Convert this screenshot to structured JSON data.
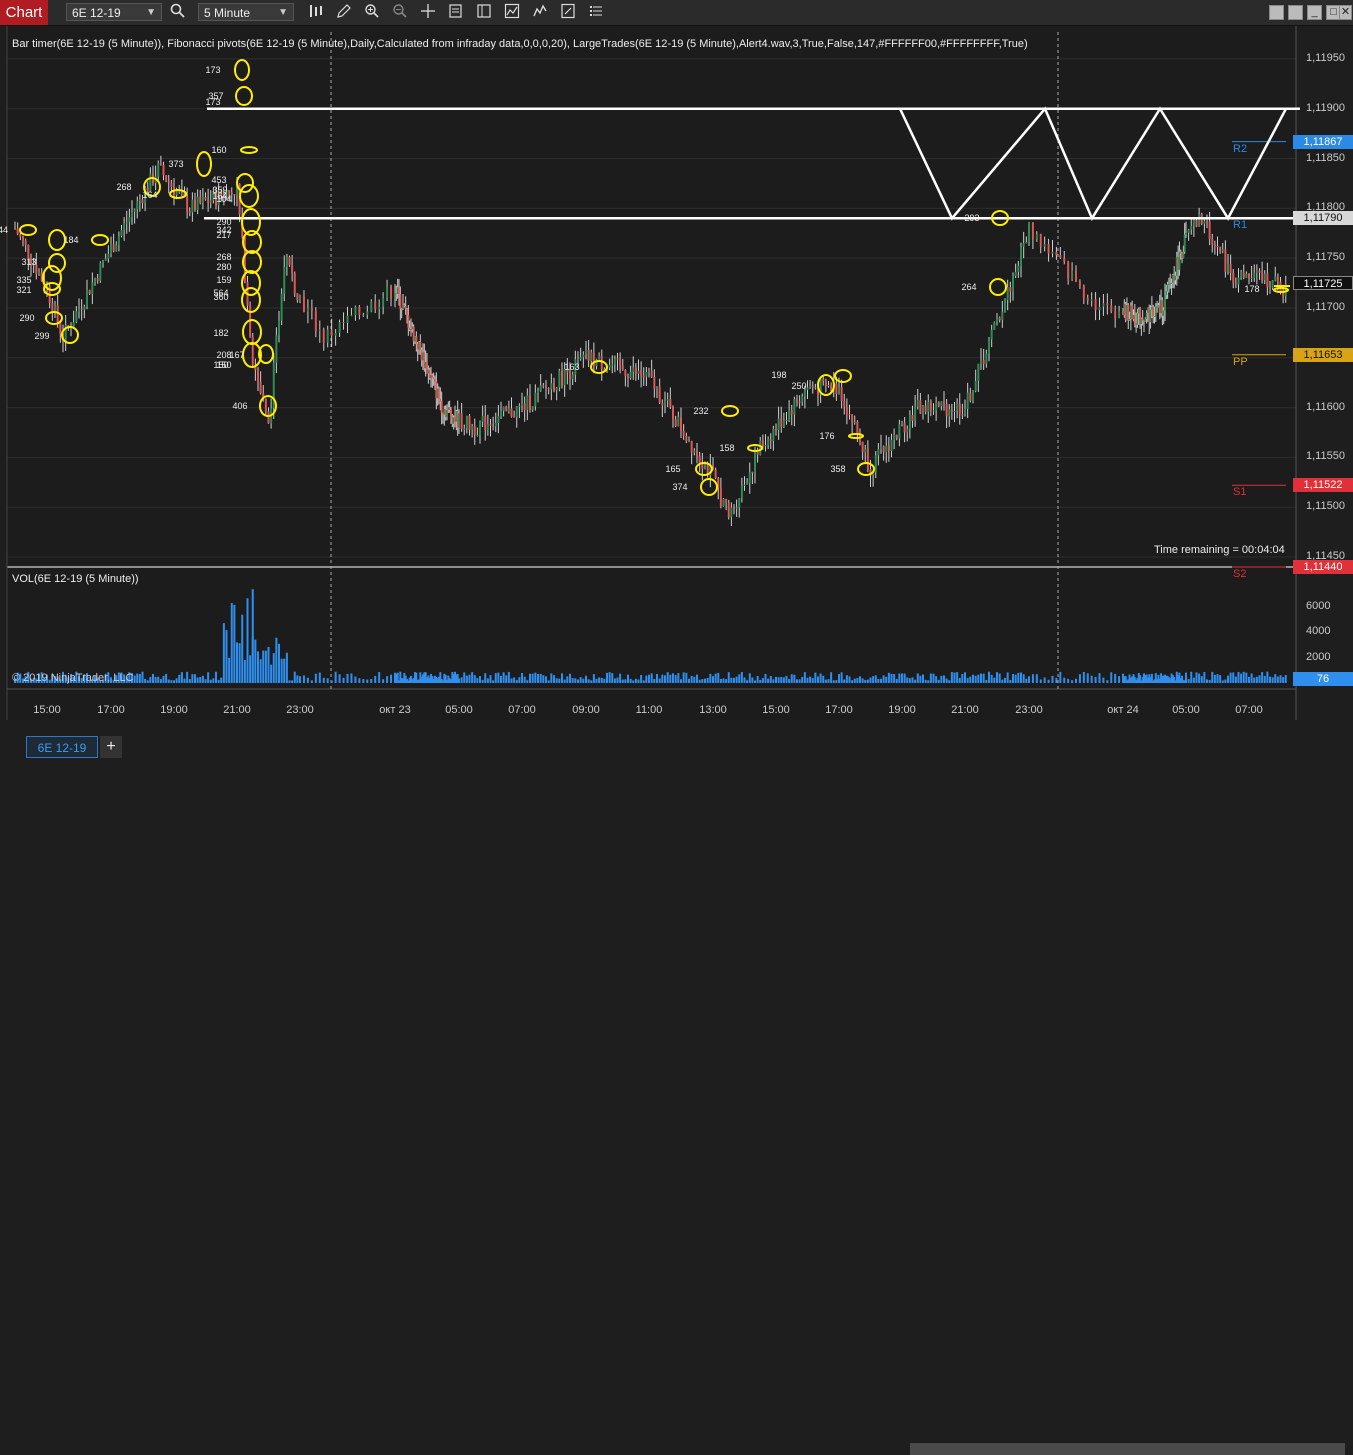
{
  "toolbar": {
    "chart_tab": "Chart",
    "instrument": "6E 12-19",
    "interval": "5 Minute",
    "icons": [
      "search-icon",
      "bar-type-icon",
      "draw-icon",
      "zoom-in-icon",
      "zoom-out-icon",
      "crosshair-icon",
      "data-box-icon",
      "chart-trader-icon",
      "strategies-icon",
      "indicators-icon",
      "properties-icon"
    ],
    "window_buttons": [
      "minimize",
      "restore",
      "maximize",
      "close"
    ]
  },
  "indicators_text": "Bar timer(6E 12-19 (5 Minute)), Fibonacci pivots(6E 12-19 (5 Minute),Daily,Calculated from infraday data,0,0,0,20), LargeTrades(6E 12-19 (5 Minute),Alert4.wav,3,True,False,147,#FFFFFF00,#FFFFFFFF,True)",
  "volume_title": "VOL(6E 12-19 (5 Minute))",
  "copyright": "© 2019 NinjaTrader, LLC",
  "time_remaining": "Time remaining = 00:04:04",
  "price_axis_ticks": [
    "1,11950",
    "1,11900",
    "1,11850",
    "1,11800",
    "1,11750",
    "1,11700",
    "1,11650",
    "1,11600",
    "1,11550",
    "1,11500",
    "1,11450"
  ],
  "price_labels": [
    {
      "value": "1,11867",
      "kind": "R2"
    },
    {
      "value": "1,11790",
      "kind": "last-bid"
    },
    {
      "value": "1,11725",
      "kind": "current"
    },
    {
      "value": "1,11653",
      "kind": "PP"
    },
    {
      "value": "1,11522",
      "kind": "S1"
    },
    {
      "value": "1,11440",
      "kind": "S2"
    }
  ],
  "pivots": {
    "R2": "R2",
    "R1": "R1",
    "PP": "PP",
    "S1": "S1",
    "S2": "S2"
  },
  "volume_axis_ticks": [
    "6000",
    "4000",
    "2000"
  ],
  "volume_last": "76",
  "time_axis": [
    "15:00",
    "17:00",
    "19:00",
    "21:00",
    "23:00",
    "окт 23",
    "05:00",
    "07:00",
    "09:00",
    "11:00",
    "13:00",
    "15:00",
    "17:00",
    "19:00",
    "21:00",
    "23:00",
    "окт 24",
    "05:00",
    "07:00"
  ],
  "bottom": {
    "instrument_tab": "6E 12-19",
    "add_tab": "+"
  },
  "colors": {
    "up": "#2e8b57",
    "down": "#e05555",
    "r_level": "#2a8ae6",
    "pp_level": "#d9a316",
    "s_level": "#e0303a",
    "trade_marker": "#ffee00",
    "volume": "#2f8fef"
  },
  "trade_labels": [
    "173",
    "357",
    "173",
    "160",
    "373",
    "268",
    "164",
    "453",
    "359",
    "164",
    "104",
    "44",
    "290",
    "342",
    "217",
    "150",
    "184",
    "313",
    "268",
    "280",
    "335",
    "321",
    "159",
    "564",
    "360",
    "290",
    "299",
    "182",
    "208",
    "167",
    "150",
    "406",
    "163",
    "232",
    "165",
    "374",
    "158",
    "198",
    "250",
    "176",
    "358",
    "293",
    "264",
    "178"
  ],
  "chart_data": {
    "type": "candlestick",
    "instrument": "6E 12-19",
    "interval": "5 Minute",
    "y_range": [
      1.1144,
      1.11975
    ],
    "x_labels": [
      "15:00",
      "17:00",
      "19:00",
      "21:00",
      "23:00",
      "окт 23",
      "05:00",
      "07:00",
      "09:00",
      "11:00",
      "13:00",
      "15:00",
      "17:00",
      "19:00",
      "21:00",
      "23:00",
      "окт 24",
      "05:00",
      "07:00"
    ],
    "approx_close_path": [
      {
        "t": "14:00",
        "close": 1.1178
      },
      {
        "t": "15:00",
        "close": 1.1172
      },
      {
        "t": "15:30",
        "close": 1.1167
      },
      {
        "t": "17:00",
        "close": 1.1176
      },
      {
        "t": "18:30",
        "close": 1.1184
      },
      {
        "t": "19:30",
        "close": 1.118
      },
      {
        "t": "21:00",
        "close": 1.1182
      },
      {
        "t": "21:30",
        "close": 1.1165
      },
      {
        "t": "22:00",
        "close": 1.1158
      },
      {
        "t": "22:30",
        "close": 1.1175
      },
      {
        "t": "23:30",
        "close": 1.1167
      },
      {
        "t": "01:00",
        "close": 1.1172
      },
      {
        "t": "02:00",
        "close": 1.1168
      },
      {
        "t": "04:00",
        "close": 1.116
      },
      {
        "t": "05:30",
        "close": 1.1158
      },
      {
        "t": "07:00",
        "close": 1.116
      },
      {
        "t": "09:00",
        "close": 1.1165
      },
      {
        "t": "11:00",
        "close": 1.1163
      },
      {
        "t": "13:00",
        "close": 1.1153
      },
      {
        "t": "13:30",
        "close": 1.1149
      },
      {
        "t": "14:30",
        "close": 1.1156
      },
      {
        "t": "16:00",
        "close": 1.1162
      },
      {
        "t": "17:00",
        "close": 1.1162
      },
      {
        "t": "18:00",
        "close": 1.1154
      },
      {
        "t": "19:30",
        "close": 1.116
      },
      {
        "t": "21:00",
        "close": 1.116
      },
      {
        "t": "22:30",
        "close": 1.1173
      },
      {
        "t": "23:00",
        "close": 1.1178
      },
      {
        "t": "00:30",
        "close": 1.117
      },
      {
        "t": "02:00",
        "close": 1.1169
      },
      {
        "t": "03:30",
        "close": 1.117
      },
      {
        "t": "05:00",
        "close": 1.1177
      },
      {
        "t": "05:30",
        "close": 1.1179
      },
      {
        "t": "06:30",
        "close": 1.1173
      },
      {
        "t": "07:30",
        "close": 1.1173
      },
      {
        "t": "08:30",
        "close": 1.1171
      }
    ],
    "levels": [
      {
        "name": "R2",
        "value": 1.11867
      },
      {
        "name": "R1",
        "value": 1.1179
      },
      {
        "name": "PP",
        "value": 1.11653
      },
      {
        "name": "S1",
        "value": 1.11522
      },
      {
        "name": "S2",
        "value": 1.1144
      }
    ],
    "drawn_lines": {
      "upper": 1.119,
      "lower": 1.1179
    },
    "volume": {
      "axis_ticks": [
        2000,
        4000,
        6000
      ],
      "last": 76,
      "peak": 7400
    }
  }
}
